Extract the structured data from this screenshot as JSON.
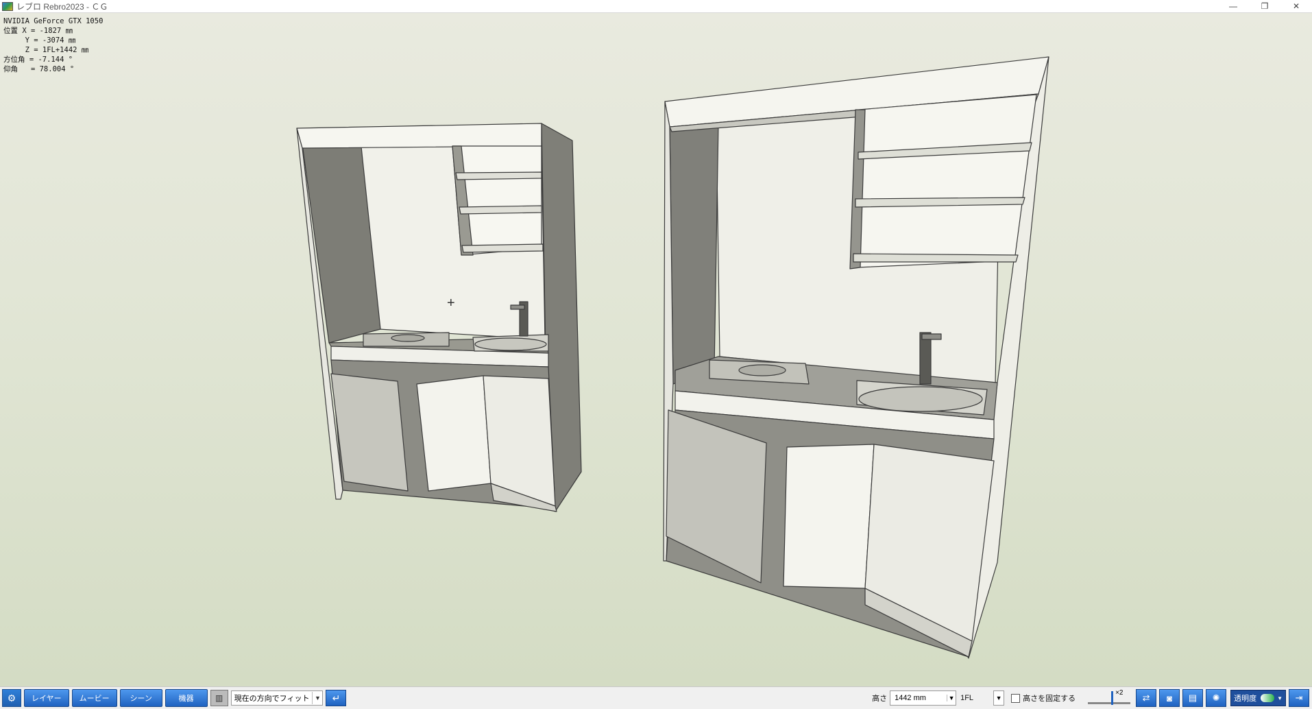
{
  "window": {
    "title": "レブロ Rebro2023 - ＣＧ",
    "minimize_glyph": "—",
    "restore_glyph": "❐",
    "close_glyph": "✕"
  },
  "overlay": {
    "gpu": "NVIDIA GeForce GTX 1050",
    "x_line": "位置 X = -1827 ㎜",
    "y_line": "     Y = -3074 ㎜",
    "z_line": "     Z = 1FL+1442 ㎜",
    "azimuth_line": "方位角 = -7.144 °",
    "elevation_line": "仰角   = 78.004 °"
  },
  "crosshair_glyph": "+",
  "statusbar": {
    "layer_label": "レイヤー",
    "movie_label": "ムービー",
    "scene_label": "シーン",
    "equipment_label": "機器",
    "fit_select": "現在の方向でフィット",
    "height_label": "高さ",
    "height_value": "1442 mm",
    "floor_value": "1FL",
    "fix_height_label": "高さを固定する",
    "zoom_label": "×2",
    "transparency_label": "透明度"
  },
  "colors": {
    "cabinet_side": "#7e7e76",
    "cabinet_light": "#f4f4ee",
    "cabinet_mid": "#cfcfc6",
    "edge": "#3a3a3a"
  }
}
